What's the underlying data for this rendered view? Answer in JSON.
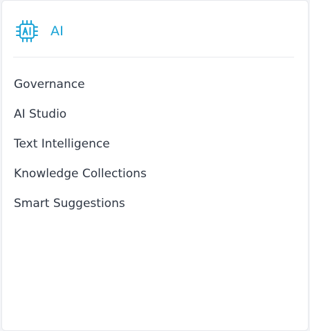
{
  "section": {
    "title": "AI",
    "icon": "ai-chip-icon",
    "accent_color": "#1aa3d6"
  },
  "menu": {
    "items": [
      {
        "label": "Governance"
      },
      {
        "label": "AI Studio"
      },
      {
        "label": "Text Intelligence"
      },
      {
        "label": "Knowledge Collections"
      },
      {
        "label": "Smart Suggestions"
      }
    ]
  }
}
